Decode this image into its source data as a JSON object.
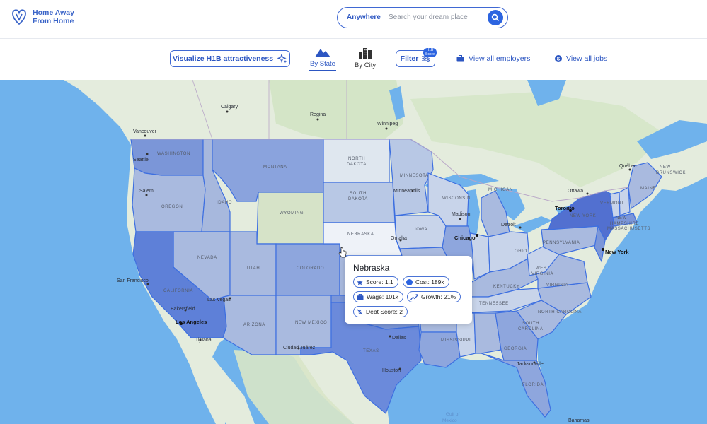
{
  "header": {
    "logo_line1": "Home Away",
    "logo_line2": "From Home",
    "search_location": "Anywhere",
    "search_placeholder": "Search your dream place"
  },
  "toolbar": {
    "visualize_label": "Visualize H1B attractiveness",
    "tab_state": "By State",
    "tab_city": "By City",
    "filter_label": "Filter",
    "filter_badge_line1": "H1B",
    "filter_badge_line2": "Score",
    "employers_label": "View all employers",
    "jobs_label": "View all jobs"
  },
  "map": {
    "states": {
      "washington": "WASHINGTON",
      "oregon": "OREGON",
      "idaho": "IDAHO",
      "montana": "MONTANA",
      "wyoming": "WYOMING",
      "nevada": "NEVADA",
      "utah": "UTAH",
      "colorado": "COLORADO",
      "california": "CALIFORNIA",
      "arizona": "ARIZONA",
      "new_mexico": "NEW MEXICO",
      "north_dakota_1": "NORTH",
      "north_dakota_2": "DAKOTA",
      "south_dakota_1": "SOUTH",
      "south_dakota_2": "DAKOTA",
      "nebraska": "NEBRASKA",
      "texas": "TEXAS",
      "minnesota": "MINNESOTA",
      "iowa": "IOWA",
      "wisconsin": "WISCONSIN",
      "michigan": "MICHIGAN",
      "ohio": "OHIO",
      "kentucky": "KENTUCKY",
      "tennessee": "TENNESSEE",
      "mississippi": "MISSISSIPPI",
      "georgia": "GEORGIA",
      "north_carolina": "NORTH CAROLINA",
      "south_carolina_1": "SOUTH",
      "south_carolina_2": "CAROLINA",
      "virginia": "VIRGINIA",
      "west_virginia_1": "WEST",
      "west_virginia_2": "VIRGINIA",
      "pennsylvania": "PENNSYLVANIA",
      "new_york": "NEW YORK",
      "maine": "MAINE",
      "vermont": "VERMONT",
      "new_hampshire_1": "NEW",
      "new_hampshire_2": "HAMPSHIRE",
      "massachusetts": "MASSACHUSETTS",
      "new_brunswick_1": "NEW",
      "new_brunswick_2": "BRUNSWICK",
      "florida": "FLORIDA"
    },
    "cities": {
      "calgary": "Calgary",
      "regina": "Regina",
      "winnipeg": "Winnipeg",
      "vancouver": "Vancouver",
      "seattle": "Seattle",
      "salem": "Salem",
      "minneapolis": "Minneapolis",
      "madison": "Madison",
      "chicago": "Chicago",
      "detroit": "Detroit",
      "toronto": "Toronto",
      "ottawa": "Ottawa",
      "quebec": "Québec",
      "new_york": "New York",
      "omaha": "Omaha",
      "san_francisco": "San Francisco",
      "las_vegas": "Las Vegas",
      "bakersfield": "Bakersfield",
      "los_angeles": "Los Angeles",
      "tijuana": "Tijuana",
      "ciudad_juarez": "Ciudad Juárez",
      "dallas": "Dallas",
      "houston": "Houston",
      "jacksonville": "Jacksonville",
      "bahamas": "Bahamas",
      "gulf_1": "Gulf of",
      "gulf_2": "Mexico"
    }
  },
  "tooltip": {
    "state": "Nebraska",
    "score": "Score: 1.1",
    "cost": "Cost: 189k",
    "wage": "Wage: 101k",
    "growth": "Growth: 21%",
    "debt": "Debt Score: 2"
  }
}
